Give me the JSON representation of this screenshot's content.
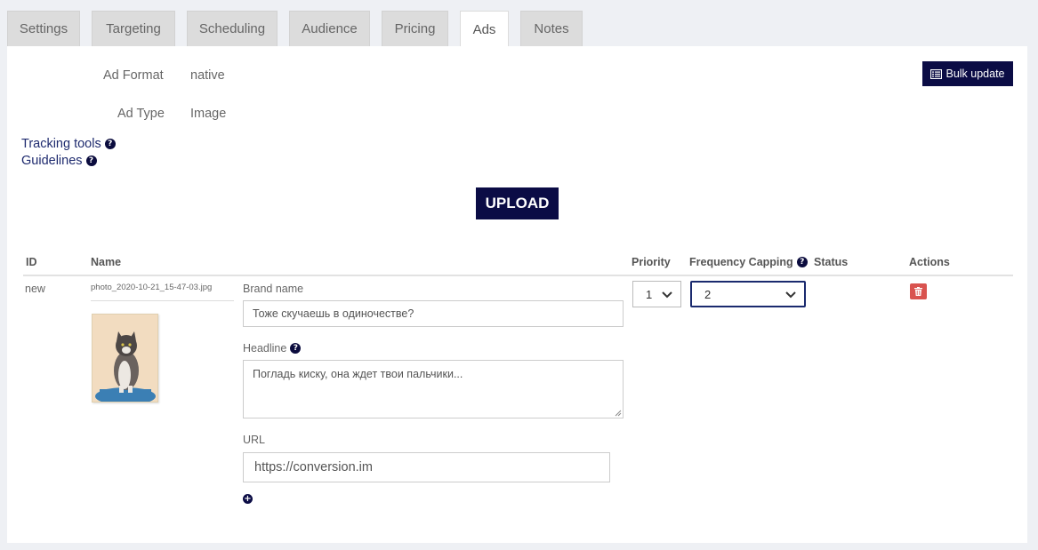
{
  "tabs": [
    {
      "label": "Settings"
    },
    {
      "label": "Targeting"
    },
    {
      "label": "Scheduling"
    },
    {
      "label": "Audience"
    },
    {
      "label": "Pricing"
    },
    {
      "label": "Ads",
      "active": true
    },
    {
      "label": "Notes"
    }
  ],
  "summary": {
    "ad_format_label": "Ad Format",
    "ad_format_value": "native",
    "ad_type_label": "Ad Type",
    "ad_type_value": "Image"
  },
  "links": {
    "tracking_tools": "Tracking tools",
    "guidelines": "Guidelines"
  },
  "buttons": {
    "bulk_update": "Bulk update",
    "upload": "UPLOAD"
  },
  "table": {
    "headers": {
      "id": "ID",
      "name": "Name",
      "priority": "Priority",
      "frequency_capping": "Frequency Capping",
      "status": "Status",
      "actions": "Actions"
    },
    "row": {
      "id": "new",
      "filename": "photo_2020-10-21_15-47-03.jpg",
      "brand_name_label": "Brand name",
      "brand_name_value": "Тоже скучаешь в одиночестве?",
      "headline_label": "Headline",
      "headline_value": "Погладь киску, она ждет твои пальчики...",
      "url_label": "URL",
      "url_value": "https://conversion.im",
      "priority_value": "1",
      "frequency_capping_value": "2",
      "status_value": ""
    }
  },
  "colors": {
    "navy": "#0b0c45",
    "delete": "#d9534f",
    "focus_border": "#1a2a6e"
  },
  "icons": {
    "bulk_update": "list-icon",
    "help": "question-circle-icon",
    "delete": "trash-icon",
    "add": "plus-circle-icon",
    "select": "chevron-down-icon"
  }
}
